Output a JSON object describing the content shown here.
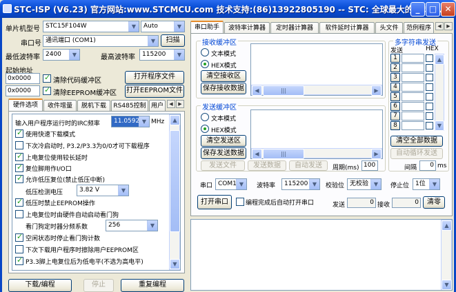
{
  "title": "STC-ISP (V6.23) 官方网站:www.STCMCU.com 技术支持:(86)13922805190 -- STC: 全球最大的8051...",
  "left": {
    "mcu_label": "单片机型号",
    "mcu_value": "STC15F104W",
    "auto_value": "Auto",
    "port_label": "串口号",
    "port_value": "通讯端口 (COM1)",
    "scan_btn": "扫描",
    "minbaud_label": "最低波特率",
    "minbaud_value": "2400",
    "maxbaud_label": "最高波特率",
    "maxbaud_value": "115200",
    "start_addr_label": "起始地址",
    "addr1": "0x0000",
    "clear_code": "清除代码缓冲区",
    "open_prog": "打开程序文件",
    "addr2": "0x0000",
    "clear_eeprom": "清除EEPROM缓冲区",
    "open_eeprom": "打开EEPROM文件",
    "tabs": [
      "硬件选项",
      "收件增量",
      "脱机下载",
      "RS485控制",
      "用户"
    ],
    "hw": {
      "freq_label": "输入用户程序运行时的IRC频率",
      "freq_value": "11.0592",
      "freq_unit": "MHz",
      "opt1": "使用快速下载模式",
      "opt2": "下次冷启动时, P3.2/P3.3为0/0才可下载程序",
      "opt3": "上电复位使用较长延时",
      "opt4": "复位脚用作I/O口",
      "opt5": "允许低压复位(禁止低压中断)",
      "lv_label": "低压检测电压",
      "lv_value": "3.82 V",
      "opt6": "低压时禁止EEPROM操作",
      "opt7": "上电复位时由硬件自动启动看门狗",
      "wdt_label": "看门狗定时器分频系数",
      "wdt_value": "256",
      "opt8": "空闲状态时停止看门狗计数",
      "opt9": "下次下载用户程序时擦除用户EEPROM区",
      "opt10": "P3.3脚上电复位后为低电平(不选为高电平)"
    },
    "download_btn": "下载/编程",
    "stop_btn": "停止",
    "reprog_btn": "重复编程"
  },
  "right": {
    "tabs": [
      "串口助手",
      "波特率计算器",
      "定时器计算器",
      "软件延时计算器",
      "头文件",
      "范例程序"
    ],
    "recv": {
      "title": "接收缓冲区",
      "text_mode": "文本模式",
      "hex_mode": "HEX模式",
      "clear": "清空接收区",
      "save": "保存接收数据"
    },
    "send": {
      "title": "发送缓冲区",
      "text_mode": "文本模式",
      "hex_mode": "HEX模式",
      "clear": "清空发送区",
      "save": "保存发送数据"
    },
    "send_file": "发送文件",
    "send_data": "发送数据",
    "auto_send": "自动发送",
    "period_label": "周期(ms)",
    "period_value": "100",
    "multi": {
      "title": "多字符串发送",
      "send_hdr": "发送",
      "hex_hdr": "HEX",
      "rows": [
        "1",
        "2",
        "3",
        "4",
        "5",
        "6",
        "7",
        "8"
      ],
      "clear_all": "清空全部数据",
      "auto_cycle": "自动循环发送",
      "interval_label": "间隔",
      "interval_value": "0",
      "interval_unit": "ms"
    },
    "port_label": "串口",
    "port_value": "COM1",
    "baud_label": "波特率",
    "baud_value": "115200",
    "parity_label": "校验位",
    "parity_value": "无校验",
    "stop_label": "停止位",
    "stop_value": "1位",
    "open_port": "打开串口",
    "auto_open": "编程完成后自动打开串口",
    "sent_label": "发送",
    "sent_value": "0",
    "recv_label": "接收",
    "recv_value": "0",
    "clear_count": "清零"
  }
}
